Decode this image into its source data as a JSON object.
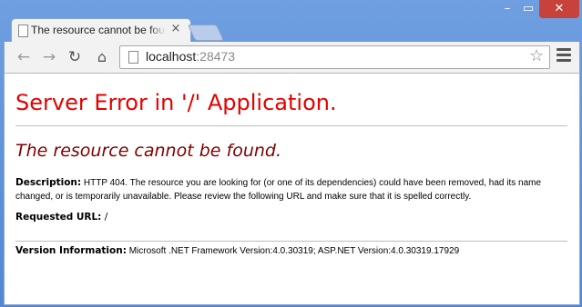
{
  "browser": {
    "tab_title": "The resource cannot be found.",
    "tab_close": "×",
    "url_host": "localhost",
    "url_port": ":28473",
    "window_minimize": "–",
    "window_maximize": "▭",
    "window_close": "✕"
  },
  "icons": {
    "back": "←",
    "forward": "→",
    "reload": "↻",
    "home": "⌂",
    "star": "☆"
  },
  "page": {
    "heading": "Server Error in '/' Application.",
    "subheading": "The resource cannot be found.",
    "description_label": "Description:",
    "description_text": "HTTP 404. The resource you are looking for (or one of its dependencies) could have been removed, had its name changed, or is temporarily unavailable.  Please review the following URL and make sure that it is spelled correctly.",
    "requested_url_label": "Requested URL:",
    "requested_url_value": "/",
    "version_label": "Version Information:",
    "version_text": "Microsoft .NET Framework Version:4.0.30319; ASP.NET Version:4.0.30319.17929"
  },
  "colors": {
    "heading": "#e60000",
    "subheading": "#800000",
    "window_frame": "#5a8fd8",
    "close_button": "#c7423b"
  }
}
